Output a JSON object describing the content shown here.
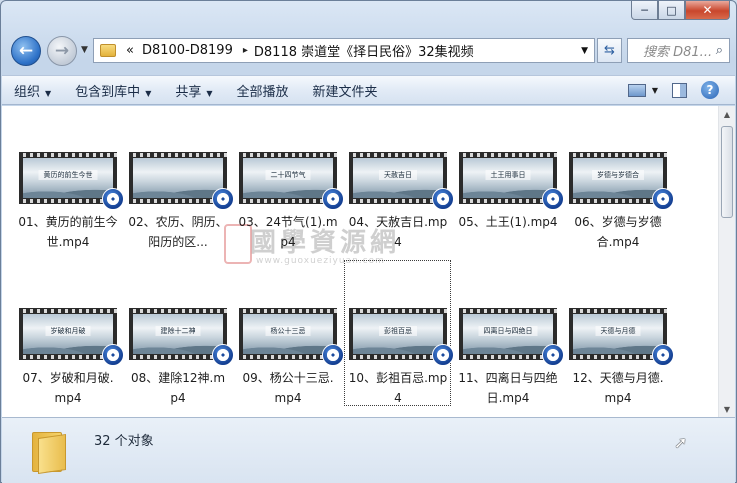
{
  "window": {
    "minimize": "─",
    "maximize": "□",
    "close": "✕"
  },
  "nav": {
    "back_glyph": "←",
    "forward_glyph": "→",
    "dropdown": "▼"
  },
  "address": {
    "overflow": "«",
    "crumbs": [
      "D8100-D8199",
      "D8118 崇道堂《择日民俗》32集视频"
    ],
    "separator": "▸",
    "dropdown": "▼"
  },
  "search": {
    "placeholder": "搜索 D81...",
    "icon": "search-icon"
  },
  "toolbar": {
    "organize": "组织",
    "include_library": "包含到库中",
    "share": "共享",
    "play_all": "全部播放",
    "new_folder": "新建文件夹",
    "help": "?"
  },
  "files": [
    {
      "name": "01、黄历的前生今世.mp4",
      "thumb_title": "黄历的前生今世"
    },
    {
      "name": "02、农历、阴历、阳历的区...",
      "thumb_title": ""
    },
    {
      "name": "03、24节气(1).mp4",
      "thumb_title": "二十四节气"
    },
    {
      "name": "04、天赦吉日.mp4",
      "thumb_title": "天赦吉日"
    },
    {
      "name": "05、土王(1).mp4",
      "thumb_title": "土王用事日"
    },
    {
      "name": "06、岁德与岁德合.mp4",
      "thumb_title": "岁德与岁德合"
    },
    {
      "name": "07、岁破和月破.mp4",
      "thumb_title": "岁破和月破"
    },
    {
      "name": "08、建除12神.mp4",
      "thumb_title": "建除十二神"
    },
    {
      "name": "09、杨公十三忌.mp4",
      "thumb_title": "杨公十三忌"
    },
    {
      "name": "10、彭祖百忌.mp4",
      "thumb_title": "彭祖百忌"
    },
    {
      "name": "11、四离日与四绝日.mp4",
      "thumb_title": "四离日与四绝日"
    },
    {
      "name": "12、天德与月德.mp4",
      "thumb_title": "天德与月德"
    }
  ],
  "watermark": {
    "text": "國學資源網",
    "url": "www.guoxueziyuan.com"
  },
  "status": {
    "count": "32 个对象"
  }
}
